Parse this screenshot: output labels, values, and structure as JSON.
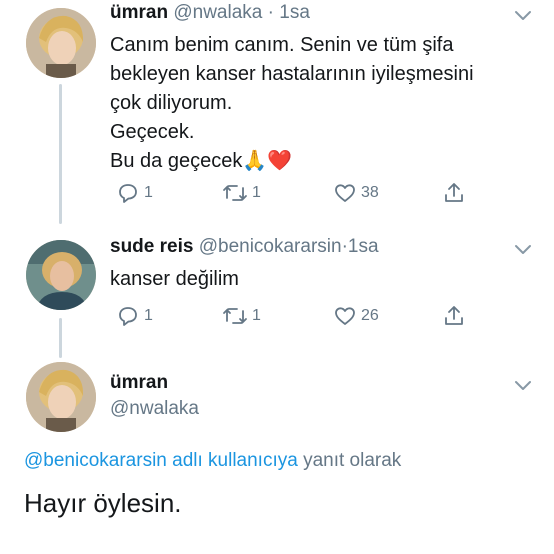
{
  "tweets": [
    {
      "name": "ümran",
      "handle": "@nwalaka",
      "dot": "·",
      "time": "1sa",
      "lines": [
        "Canım benim canım.  Senin ve tüm şifa",
        "bekleyen kanser hastalarının iyileşmesini",
        "çok diliyorum.",
        "Geçecek.",
        "Bu da geçecek"
      ],
      "emoji": "🙏❤️",
      "replies": "1",
      "retweets": "1",
      "likes": "38"
    },
    {
      "name": "sude reis",
      "handle": "@benicokararsin",
      "dot": "·",
      "time": "1sa",
      "lines": [
        "kanser değilim"
      ],
      "replies": "1",
      "retweets": "1",
      "likes": "26"
    }
  ],
  "main_tweet": {
    "name": "ümran",
    "handle": "@nwalaka",
    "reply_link": "@benicokararsin adlı kullanıcıya",
    "reply_suffix": " yanıt olarak",
    "text": "Hayır öylesin."
  },
  "icons": [
    "reply-icon",
    "retweet-icon",
    "like-icon",
    "share-icon",
    "chevron-down-icon"
  ],
  "colors": {
    "link": "#1b95e0",
    "muted": "#657786",
    "line": "#ccd6dd"
  }
}
